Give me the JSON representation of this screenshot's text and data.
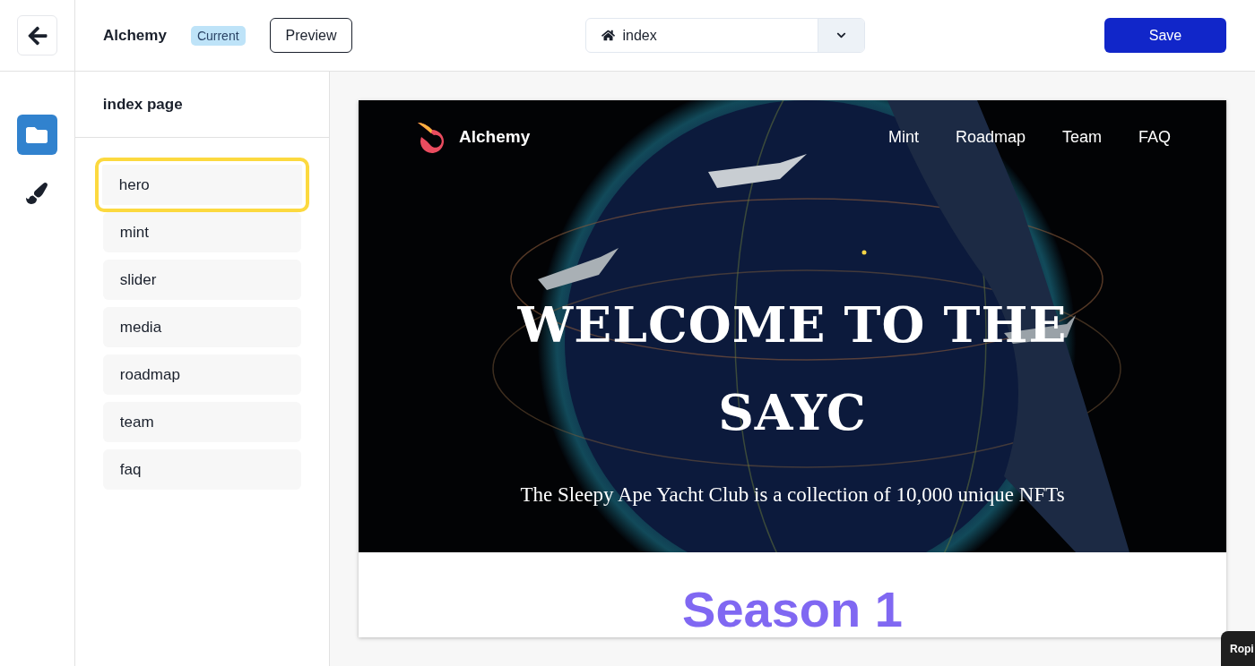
{
  "topbar": {
    "project": "Alchemy",
    "badge": "Current",
    "preview_button": "Preview",
    "page_select": {
      "value": "index"
    },
    "save_button": "Save"
  },
  "rail": [
    {
      "kind": "folder",
      "selected": true
    },
    {
      "kind": "brush",
      "selected": false
    }
  ],
  "sections_panel": {
    "title": "index page",
    "items": [
      {
        "label": "hero",
        "selected": true
      },
      {
        "label": "mint",
        "selected": false
      },
      {
        "label": "slider",
        "selected": false
      },
      {
        "label": "media",
        "selected": false
      },
      {
        "label": "roadmap",
        "selected": false
      },
      {
        "label": "team",
        "selected": false
      },
      {
        "label": "faq",
        "selected": false
      }
    ]
  },
  "preview": {
    "brand": "Alchemy",
    "nav": [
      "Mint",
      "Roadmap",
      "Team",
      "FAQ"
    ],
    "headline": "WELCOME TO THE SAYC",
    "subtitle": "The Sleepy Ape Yacht Club is a collection of 10,000 unique NFTs",
    "next_heading": "Season 1"
  },
  "toast": {
    "title": "Ropi"
  }
}
